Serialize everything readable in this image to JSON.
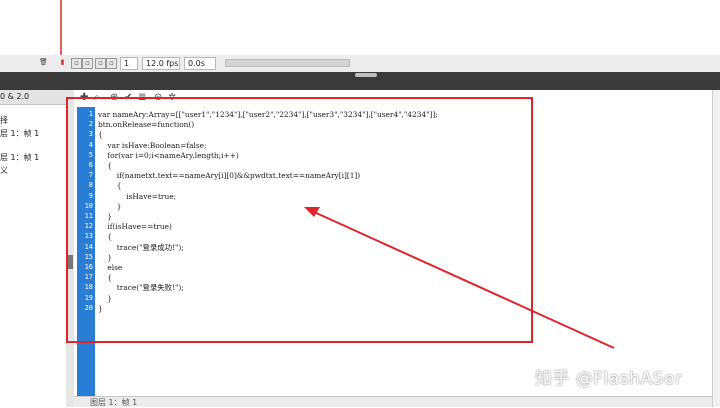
{
  "timeline": {
    "frame_number": "1",
    "fps": "12.0 fps",
    "time": "0.0s"
  },
  "left_panel": {
    "header": "0 & 2.0",
    "items": [
      "择",
      "层 1：帧 1",
      "层 1：帧 1",
      "义"
    ]
  },
  "code_lines": [
    {
      "n": "1",
      "text": "var nameAry:Array=[[\"user1\",\"1234\"],[\"user2\",\"2234\"],[\"user3\",\"3234\"],[\"user4\",\"4234\"]];"
    },
    {
      "n": "2",
      "text": "btn.onRelease=function()"
    },
    {
      "n": "3",
      "text": "{"
    },
    {
      "n": "4",
      "text": "    var isHave:Boolean=false;"
    },
    {
      "n": "5",
      "text": "    for(var i=0;i<nameAry.length;i++)"
    },
    {
      "n": "6",
      "text": "    {"
    },
    {
      "n": "7",
      "text": "        if(nametxt.text==nameAry[i][0]&&pwdtxt.text==nameAry[i][1])"
    },
    {
      "n": "8",
      "text": "        {"
    },
    {
      "n": "9",
      "text": "            isHave=true;"
    },
    {
      "n": "10",
      "text": "        }"
    },
    {
      "n": "11",
      "text": "    }"
    },
    {
      "n": "12",
      "text": "    if(isHave==true)"
    },
    {
      "n": "13",
      "text": "    {"
    },
    {
      "n": "14",
      "text": "        trace(\"登录成功!\");"
    },
    {
      "n": "15",
      "text": "    }"
    },
    {
      "n": "16",
      "text": "    else"
    },
    {
      "n": "17",
      "text": "    {"
    },
    {
      "n": "18",
      "text": "        trace(\"登录失败!\");"
    },
    {
      "n": "19",
      "text": "    }"
    },
    {
      "n": "20",
      "text": "}"
    }
  ],
  "bottom_strip": {
    "label": "图层 1：帧 1"
  },
  "watermark": "知乎 @FlashASer",
  "colors": {
    "annotation": "#e0242c",
    "gutter": "#2a7dd4",
    "divider": "#3a3a3a"
  }
}
